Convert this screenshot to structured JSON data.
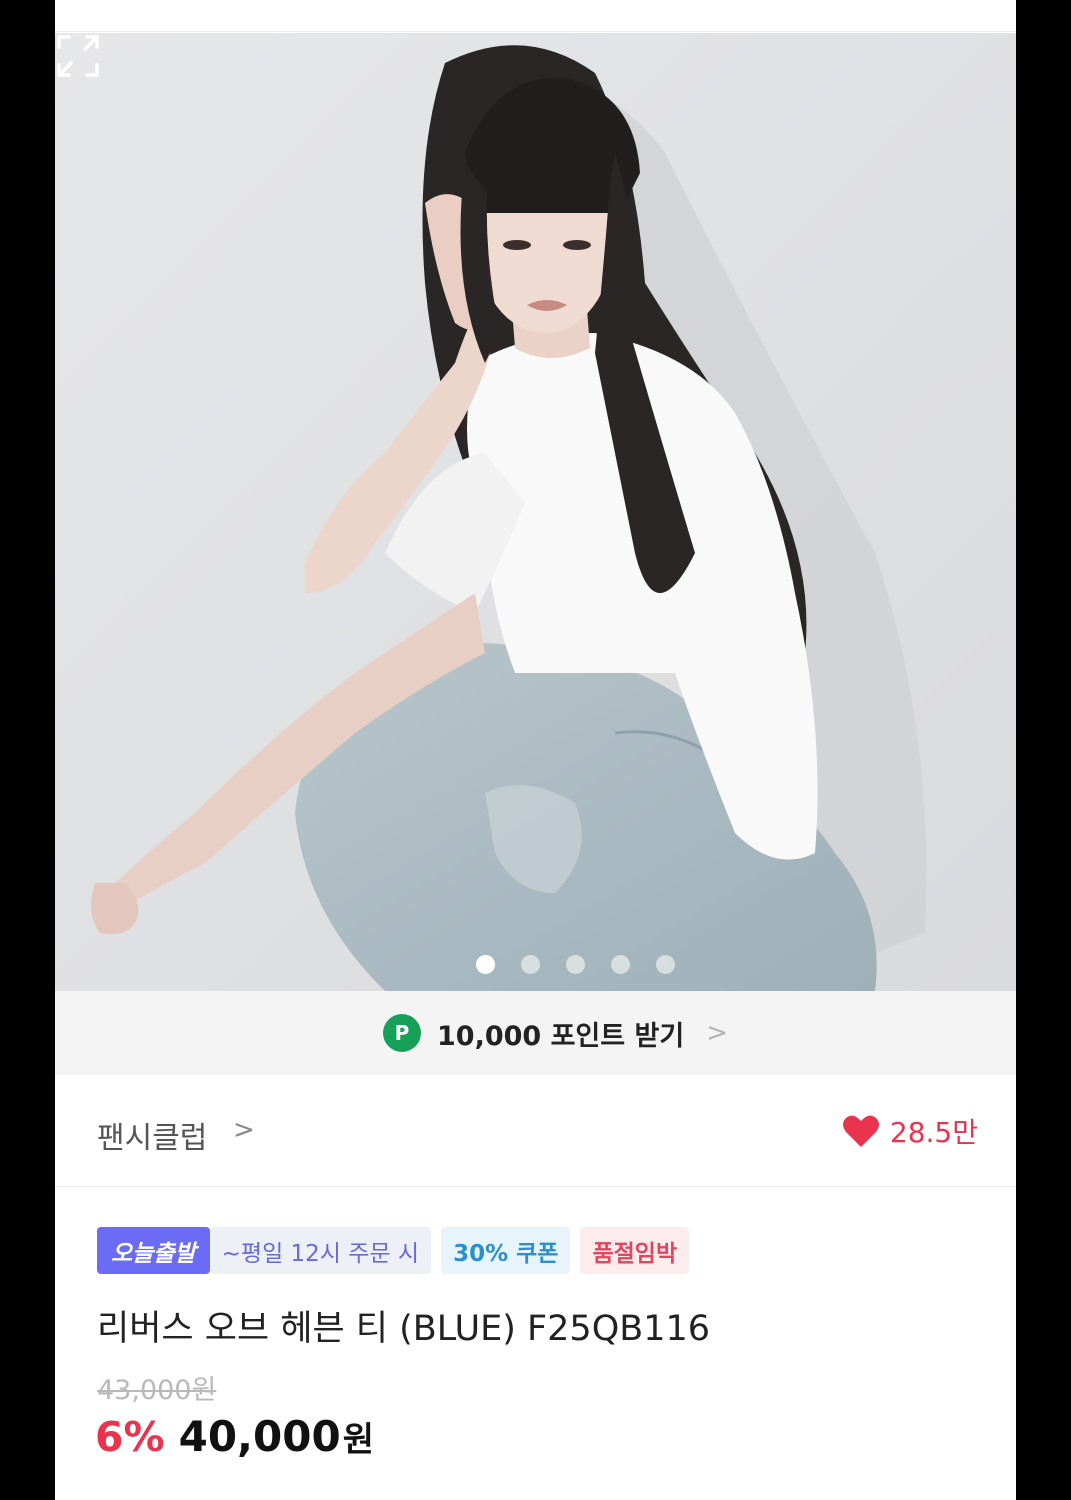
{
  "photo": {
    "slide_count": 5,
    "active_index": 0,
    "expand_icon": "expand-icon"
  },
  "points": {
    "badge": "P",
    "text": "10,000 포인트 받기",
    "chevron": ">"
  },
  "brand": {
    "name": "팬시클럽",
    "chevron": ">",
    "like_count": "28.5만",
    "like_icon": "heart-icon",
    "like_color": "#e8344e"
  },
  "badges": {
    "today": "오늘출발",
    "cutoff": "~평일 12시 주문 시",
    "coupon": "30% 쿠폰",
    "soldout": "품절임박"
  },
  "product": {
    "title": "리버스 오브 헤븐 티 (BLUE) F25QB116",
    "original_price": "43,000원",
    "discount": "6%",
    "sale_price": "40,000",
    "currency": "원"
  }
}
